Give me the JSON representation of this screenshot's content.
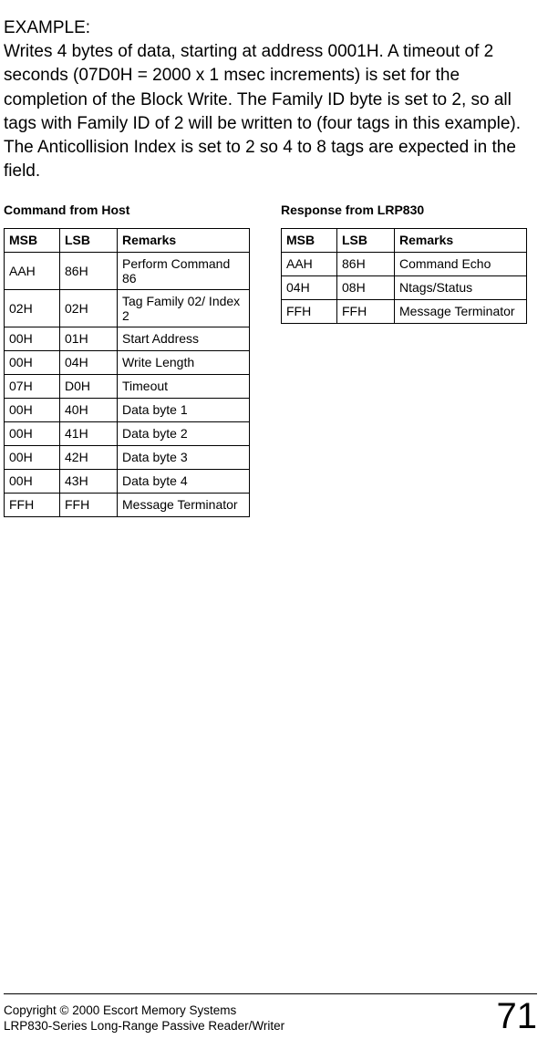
{
  "example_label": "EXAMPLE:",
  "body_text": "Writes 4 bytes of data, starting at address 0001H. A timeout of 2 seconds (07D0H = 2000 x 1 msec increments) is set for the completion of the Block Write.  The Family ID byte is set to 2, so all tags with Family ID of 2 will be written to (four tags in this example).  The Anticollision Index is set to 2 so 4 to 8 tags are expected in the field.",
  "left": {
    "title": "Command from Host",
    "headers": {
      "msb": "MSB",
      "lsb": "LSB",
      "rem": "Remarks"
    },
    "rows": [
      {
        "msb": "AAH",
        "lsb": "86H",
        "rem": "Perform Command 86"
      },
      {
        "msb": "02H",
        "lsb": "02H",
        "rem": "Tag Family 02/ Index 2"
      },
      {
        "msb": "00H",
        "lsb": "01H",
        "rem": "Start Address"
      },
      {
        "msb": "00H",
        "lsb": "04H",
        "rem": "Write Length"
      },
      {
        "msb": "07H",
        "lsb": "D0H",
        "rem": "Timeout"
      },
      {
        "msb": "00H",
        "lsb": "40H",
        "rem": "Data byte 1"
      },
      {
        "msb": "00H",
        "lsb": "41H",
        "rem": "Data byte 2"
      },
      {
        "msb": "00H",
        "lsb": "42H",
        "rem": "Data byte 3"
      },
      {
        "msb": "00H",
        "lsb": "43H",
        "rem": "Data byte 4"
      },
      {
        "msb": "FFH",
        "lsb": "FFH",
        "rem": "Message Terminator"
      }
    ]
  },
  "right": {
    "title": "Response from LRP830",
    "headers": {
      "msb": "MSB",
      "lsb": "LSB",
      "rem": "Remarks"
    },
    "rows": [
      {
        "msb": "AAH",
        "lsb": "86H",
        "rem": "Command Echo"
      },
      {
        "msb": "04H",
        "lsb": "08H",
        "rem": "Ntags/Status"
      },
      {
        "msb": "FFH",
        "lsb": "FFH",
        "rem": "Message Terminator"
      }
    ]
  },
  "footer": {
    "line1": "Copyright © 2000 Escort Memory Systems",
    "line2": "LRP830-Series Long-Range Passive Reader/Writer",
    "page": "71"
  }
}
